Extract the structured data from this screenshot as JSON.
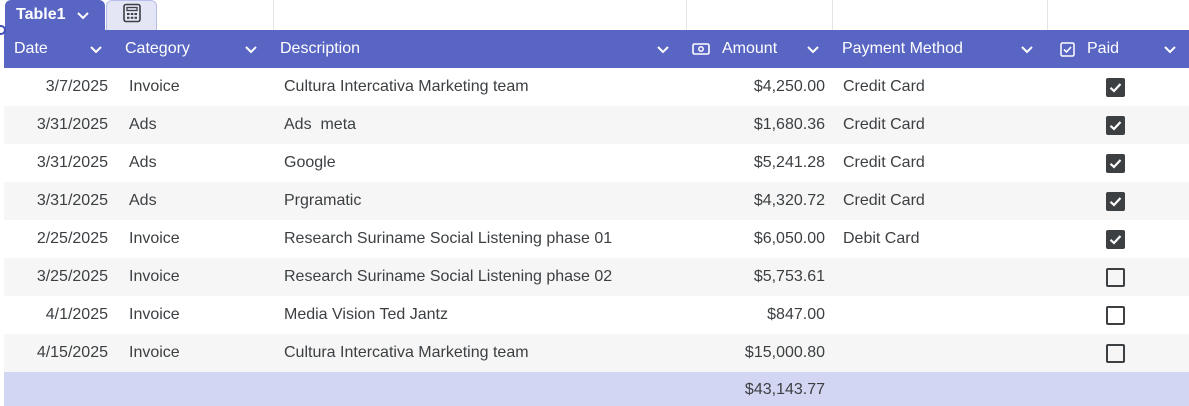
{
  "tab": {
    "name": "Table1"
  },
  "columns": {
    "date": "Date",
    "category": "Category",
    "description": "Description",
    "amount": "Amount",
    "payment": "Payment Method",
    "paid": "Paid"
  },
  "rows": [
    {
      "date": "3/7/2025",
      "category": "Invoice",
      "description": "Cultura Intercativa Marketing team",
      "amount": "$4,250.00",
      "payment": "Credit Card",
      "paid": true
    },
    {
      "date": "3/31/2025",
      "category": "Ads",
      "description": "Ads  meta",
      "amount": "$1,680.36",
      "payment": "Credit Card",
      "paid": true
    },
    {
      "date": "3/31/2025",
      "category": "Ads",
      "description": "Google",
      "amount": "$5,241.28",
      "payment": "Credit Card",
      "paid": true
    },
    {
      "date": "3/31/2025",
      "category": "Ads",
      "description": "Prgramatic",
      "amount": "$4,320.72",
      "payment": "Credit Card",
      "paid": true
    },
    {
      "date": "2/25/2025",
      "category": "Invoice",
      "description": "Research Suriname Social Listening phase 01",
      "amount": "$6,050.00",
      "payment": "Debit Card",
      "paid": true
    },
    {
      "date": "3/25/2025",
      "category": "Invoice",
      "description": "Research Suriname Social Listening phase 02",
      "amount": "$5,753.61",
      "payment": "",
      "paid": false
    },
    {
      "date": "4/1/2025",
      "category": "Invoice",
      "description": "Media Vision Ted Jantz",
      "amount": "$847.00",
      "payment": "",
      "paid": false
    },
    {
      "date": "4/15/2025",
      "category": "Invoice",
      "description": "Cultura Intercativa Marketing team",
      "amount": "$15,000.80",
      "payment": "",
      "paid": false
    }
  ],
  "total": {
    "amount": "$43,143.77"
  },
  "icons": {
    "tab_dropdown": "chevron-down-icon",
    "calc": "calculator-icon",
    "amount_type": "currency-icon",
    "paid_type": "checkbox-icon"
  },
  "colors": {
    "header": "#5865c2",
    "total_row": "#d3d6f2",
    "checkbox": "#3c4043"
  }
}
